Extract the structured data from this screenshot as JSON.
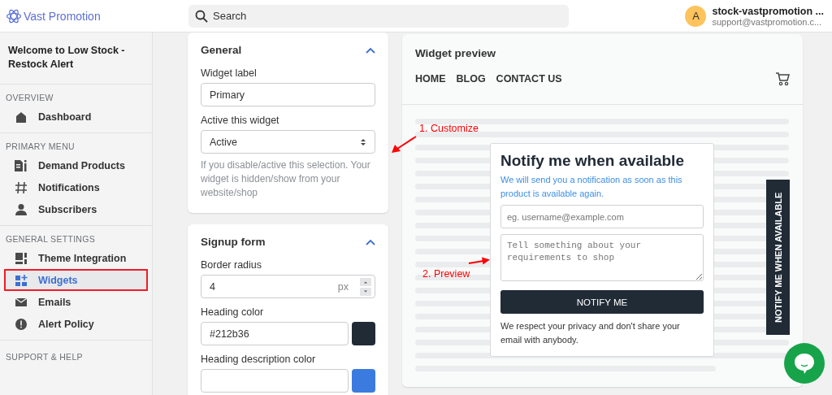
{
  "header": {
    "logo": "Vast Promotion",
    "search": {
      "placeholder": "Search"
    },
    "account": {
      "avatar": "A",
      "name": "stock-vastpromotion ...",
      "email": "support@vastpromotion.c..."
    }
  },
  "sidebar": {
    "welcome": "Welcome to Low Stock - Restock Alert",
    "sections": [
      {
        "title": "OVERVIEW",
        "items": [
          {
            "label": "Dashboard",
            "selected": false,
            "marked": false
          }
        ]
      },
      {
        "title": "PRIMARY MENU",
        "items": [
          {
            "label": "Demand Products",
            "selected": false,
            "marked": false
          },
          {
            "label": "Notifications",
            "selected": false,
            "marked": false
          },
          {
            "label": "Subscribers",
            "selected": false,
            "marked": false
          }
        ]
      },
      {
        "title": "GENERAL SETTINGS",
        "items": [
          {
            "label": "Theme Integration",
            "selected": false,
            "marked": false
          },
          {
            "label": "Widgets",
            "selected": true,
            "marked": true
          },
          {
            "label": "Emails",
            "selected": false,
            "marked": false
          },
          {
            "label": "Alert Policy",
            "selected": false,
            "marked": false
          }
        ]
      },
      {
        "title": "SUPPORT & HELP"
      }
    ]
  },
  "settings": [
    {
      "title": "General",
      "expanded": true,
      "fields": [
        {
          "kind": "text",
          "label": "Widget label",
          "value": "Primary"
        },
        {
          "kind": "select",
          "label": "Active this widget",
          "value": "Active",
          "help": "If you disable/active this selection. Your widget is hidden/show from your website/shop"
        }
      ]
    },
    {
      "title": "Signup form",
      "expanded": true,
      "fields": [
        {
          "kind": "number",
          "label": "Border radius",
          "value": "4",
          "unit": "px"
        },
        {
          "kind": "color",
          "label": "Heading color",
          "value": "#212b36",
          "color": "#212b36"
        },
        {
          "kind": "color",
          "label": "Heading description color",
          "color": "#3b7be0"
        }
      ]
    }
  ],
  "preview": {
    "title": "Widget preview",
    "nav": [
      "HOME",
      "BLOG",
      "CONTACT US"
    ],
    "popup": {
      "title": "Notify me when available",
      "description": "We will send you a notification as soon as this product is available again.",
      "email_placeholder": "eg. username@example.com",
      "message_placeholder": "Tell something about your requirements to shop",
      "button": "NOTIFY ME",
      "note": "We respect your privacy and don't share your email with anybody."
    },
    "side_tab": "NOTIFY ME WHEN AVAILABLE"
  },
  "annotations": [
    {
      "text": "1. Customize"
    },
    {
      "text": "2. Preview"
    }
  ]
}
